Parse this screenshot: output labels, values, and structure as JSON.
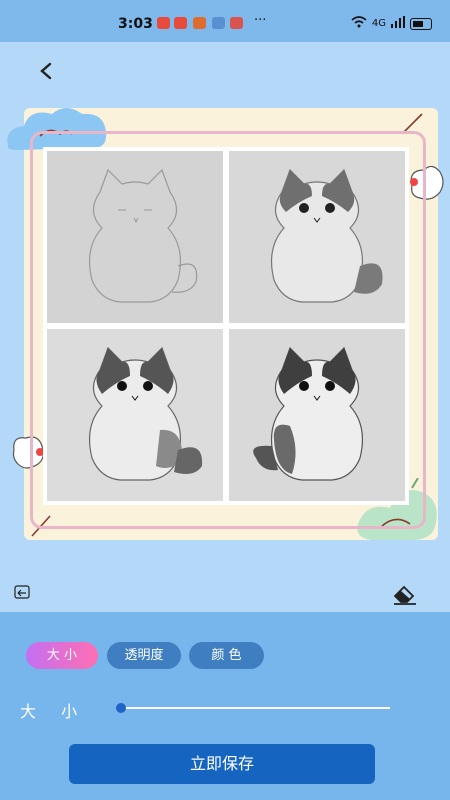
{
  "status_bar": {
    "time": "3:03",
    "dots": "···",
    "network": "4G"
  },
  "canvas": {
    "back_icon": "chevron-left-icon",
    "undo_icon": "undo-icon",
    "eraser_icon": "eraser-icon"
  },
  "tools": {
    "tabs": [
      {
        "label": "大 小",
        "active": true
      },
      {
        "label": "透明度",
        "active": false
      },
      {
        "label": "颜 色",
        "active": false
      }
    ],
    "size_label": "大 小",
    "size_value": 0
  },
  "actions": {
    "save_label": "立即保存"
  },
  "colors": {
    "accent": "#1565c0",
    "active_tab_start": "#c46ff2",
    "active_tab_end": "#ff6fb2",
    "panel": "#76b6ec"
  }
}
